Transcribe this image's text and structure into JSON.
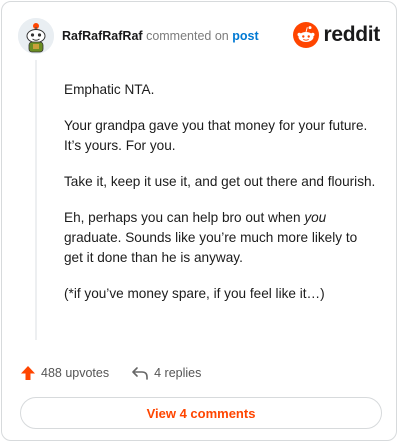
{
  "comment": {
    "username": "RafRafRafRaf",
    "action_text": "commented on",
    "post_link": "post",
    "paragraphs": [
      "Emphatic NTA.",
      "Your grandpa gave you that money for your future. It’s yours. For you.",
      "Take it, keep it use it, and get out there and flourish."
    ],
    "p4_before": "Eh, perhaps you can help bro out when ",
    "p4_em": "you",
    "p4_after": " graduate. Sounds like you’re much more likely to get it done than he is anyway.",
    "p5": "(*if you’ve money spare, if you feel like it…)"
  },
  "brand": {
    "word": "reddit",
    "color": "#ff4500"
  },
  "stats": {
    "upvotes": "488 upvotes",
    "replies": "4 replies",
    "upvote_color": "#ff4500"
  },
  "footer": {
    "view_comments": "View 4 comments"
  }
}
